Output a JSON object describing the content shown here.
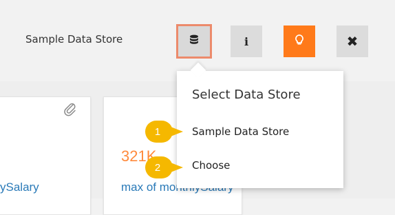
{
  "toolbar": {
    "data_store_label": "Sample Data Store",
    "info_label": "i",
    "close_label": "✖",
    "accent_color": "#ff7a1a",
    "highlight_border_color": "#ec8a6b",
    "icons": [
      "database-icon",
      "info-icon",
      "lightbulb-icon",
      "close-icon"
    ]
  },
  "cards": {
    "left_title": "ySalary",
    "mid_title": "max of monthlySalary",
    "mid_value": "321K"
  },
  "dropdown": {
    "header": "Select Data Store",
    "items": [
      {
        "label": "Sample Data Store"
      },
      {
        "label": "Choose"
      }
    ]
  },
  "steps": [
    {
      "number": "1"
    },
    {
      "number": "2"
    }
  ],
  "colors": {
    "step_marker": "#f5b800",
    "link_text": "#2a7ab8",
    "kpi_value": "#ff8a3c"
  }
}
